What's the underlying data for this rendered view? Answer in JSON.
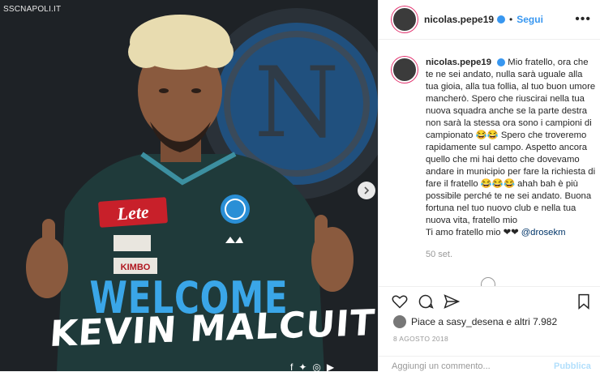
{
  "image": {
    "watermark": "SSCNAPOLI.IT",
    "welcome_text": "WELCOME",
    "player_name": "KEVIN MALCUIT",
    "sponsor_main": "Lete",
    "sponsor_second": "KIMBO",
    "crest_letter": "N",
    "colors": {
      "background": "#1e2226",
      "shirt": "#1f3a3a",
      "welcome": "#3aa6e8",
      "crest_blue": "#1769b8"
    }
  },
  "header": {
    "username": "nicolas.pepe19",
    "separator": "•",
    "follow_label": "Segui",
    "more_icon": "more-horizontal-icon"
  },
  "caption": {
    "username": "nicolas.pepe19",
    "text": "Mio fratello, ora che te ne sei andato, nulla sarà uguale alla tua gioia, alla tua follia, al tuo buon umore mancherò. Spero che riuscirai nella tua nuova squadra anche se la parte destra non sarà la stessa ora sono i campioni di campionato 😂😂 Spero che troveremo rapidamente sul campo. Aspetto ancora quello che mi hai detto che dovevamo andare in municipio per fare la richiesta di fare il fratello 😂😂😂 ahah bah è più possibile perché te ne sei andato. Buona fortuna nel tuo nuovo club e nella tua nuova vita, fratello mio",
    "last_line": "Ti amo fratello mio ❤❤",
    "mention": "@drosekm",
    "time": "50 set."
  },
  "actions": {
    "like_icon": "heart-icon",
    "comment_icon": "comment-icon",
    "share_icon": "share-icon",
    "save_icon": "bookmark-icon"
  },
  "likes": {
    "text": "Piace a sasy_desena e altri 7.982"
  },
  "date": "8 AGOSTO 2018",
  "comment_box": {
    "placeholder": "Aggiungi un commento...",
    "publish_label": "Pubblica"
  }
}
